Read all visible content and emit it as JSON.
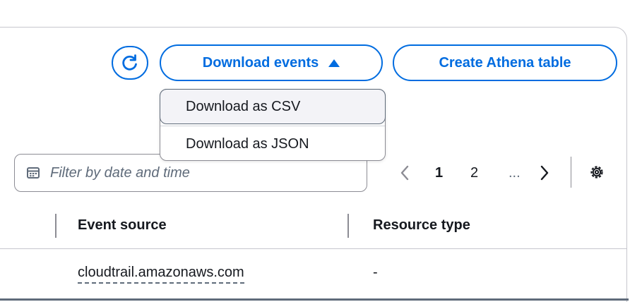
{
  "toolbar": {
    "refresh_icon": "refresh-icon",
    "download_label": "Download events",
    "download_caret_icon": "caret-up-icon",
    "athena_label": "Create Athena table",
    "accent": "#006ce0"
  },
  "download_menu": {
    "items": [
      {
        "label": "Download as CSV"
      },
      {
        "label": "Download as JSON"
      }
    ]
  },
  "filter": {
    "icon": "calendar-icon",
    "placeholder": "Filter by date and time"
  },
  "pagination": {
    "prev_icon": "chevron-left-icon",
    "pages": [
      "1",
      "2"
    ],
    "current": "1",
    "ellipsis": "...",
    "next_icon": "chevron-right-icon",
    "settings_icon": "gear-icon"
  },
  "table": {
    "columns": [
      "Event source",
      "Resource type"
    ],
    "rows": [
      {
        "event_source": "cloudtrail.amazonaws.com",
        "resource_type": "-"
      }
    ]
  }
}
